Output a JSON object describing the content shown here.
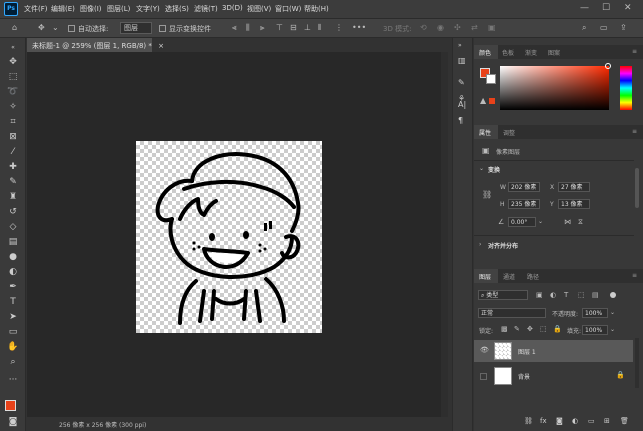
{
  "menubar": {
    "logo": "Ps",
    "items": [
      "文件(F)",
      "编辑(E)",
      "图像(I)",
      "图层(L)",
      "文字(Y)",
      "选择(S)",
      "滤镜(T)",
      "3D(D)",
      "视图(V)",
      "窗口(W)",
      "帮助(H)"
    ]
  },
  "options": {
    "auto_select_label": "自动选择:",
    "auto_select_value": "图层",
    "transform_label": "显示变换控件",
    "mode_3d": "3D 模式:"
  },
  "document": {
    "tab_title": "未标题-1 @ 259% (图层 1, RGB/8) *",
    "tab_close": "×",
    "status": "256 像素 x 256 像素 (300 ppi)"
  },
  "color_panel": {
    "tabs": [
      "颜色",
      "色板",
      "渐变",
      "图案"
    ],
    "fg_color": "#e8421a",
    "bg_color": "#ffffff"
  },
  "properties_panel": {
    "tabs": [
      "属性",
      "调整"
    ],
    "layer_type": "像素图层",
    "transform_header": "变换",
    "w_label": "W",
    "w_value": "202 像素",
    "x_label": "X",
    "x_value": "27 像素",
    "h_label": "H",
    "h_value": "235 像素",
    "y_label": "Y",
    "y_value": "13 像素",
    "angle_value": "0.00°",
    "align_header": "对齐并分布"
  },
  "layers_panel": {
    "tabs": [
      "图层",
      "通道",
      "路径"
    ],
    "filter_label": "类型",
    "blend_mode": "正常",
    "opacity_label": "不透明度:",
    "opacity_value": "100%",
    "lock_label": "锁定:",
    "fill_label": "填充:",
    "fill_value": "100%",
    "layers": [
      {
        "name": "图层 1"
      },
      {
        "name": "背景"
      }
    ]
  }
}
